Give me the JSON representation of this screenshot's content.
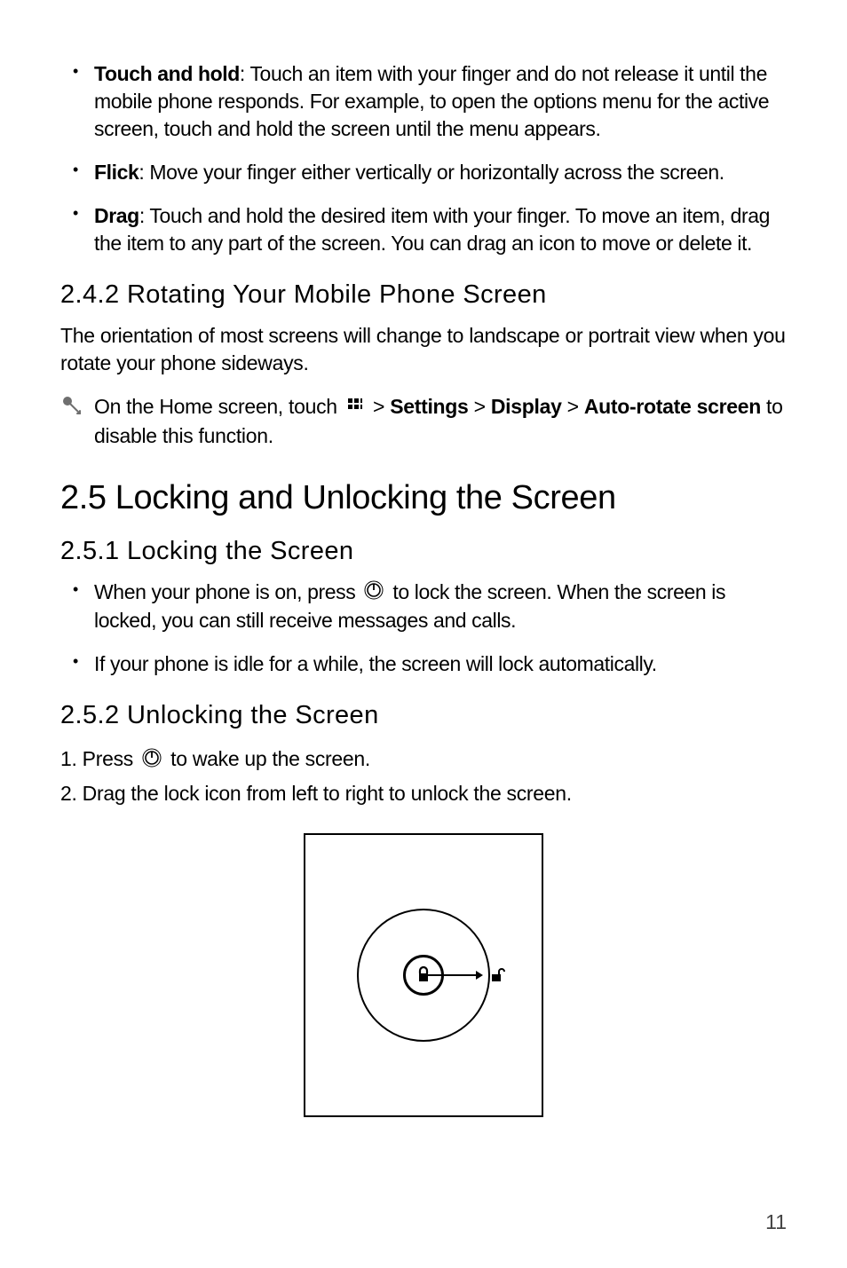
{
  "gestures": [
    {
      "label": "Touch and hold",
      "text": ": Touch an item with your finger and do not release it until the mobile phone responds. For example, to open the options menu for the active screen, touch and hold the screen until the menu appears."
    },
    {
      "label": "Flick",
      "text": ": Move your finger either vertically or horizontally across the screen."
    },
    {
      "label": "Drag",
      "text": ": Touch and hold the desired item with your finger. To move an item, drag the item to any part of the screen. You can drag an icon to move or delete it."
    }
  ],
  "section_242": {
    "heading": "2.4.2  Rotating Your Mobile Phone Screen",
    "body": "The orientation of most screens will change to landscape or portrait view when you rotate your phone sideways.",
    "tip": {
      "prefix": "On the Home screen, touch ",
      "mid": "  > ",
      "strong1": "Settings",
      "sep1": " > ",
      "strong2": "Display",
      "sep2": " > ",
      "strong3": "Auto-rotate screen",
      "suffix": " to disable this function."
    }
  },
  "section_25": {
    "heading": "2.5  Locking and Unlocking the Screen"
  },
  "section_251": {
    "heading": "2.5.1  Locking the Screen",
    "items": {
      "i0": {
        "pre": "When your phone is on, press ",
        "post": "  to lock the screen. When the screen is locked, you can still receive messages and calls."
      },
      "i1": {
        "text": "If your phone is idle for a while, the screen will lock automatically."
      }
    }
  },
  "section_252": {
    "heading": "2.5.2  Unlocking the Screen",
    "step1": {
      "pre": "1. Press ",
      "post": "  to wake up the screen."
    },
    "step2": "2. Drag the lock icon from left to right to unlock the screen."
  },
  "page_number": "11",
  "icons": {
    "tip": "tip-cursor-icon",
    "apps": "apps-grid-icon",
    "power": "power-icon",
    "lock_solid": "lock-solid-icon",
    "lock_open": "lock-open-icon"
  }
}
